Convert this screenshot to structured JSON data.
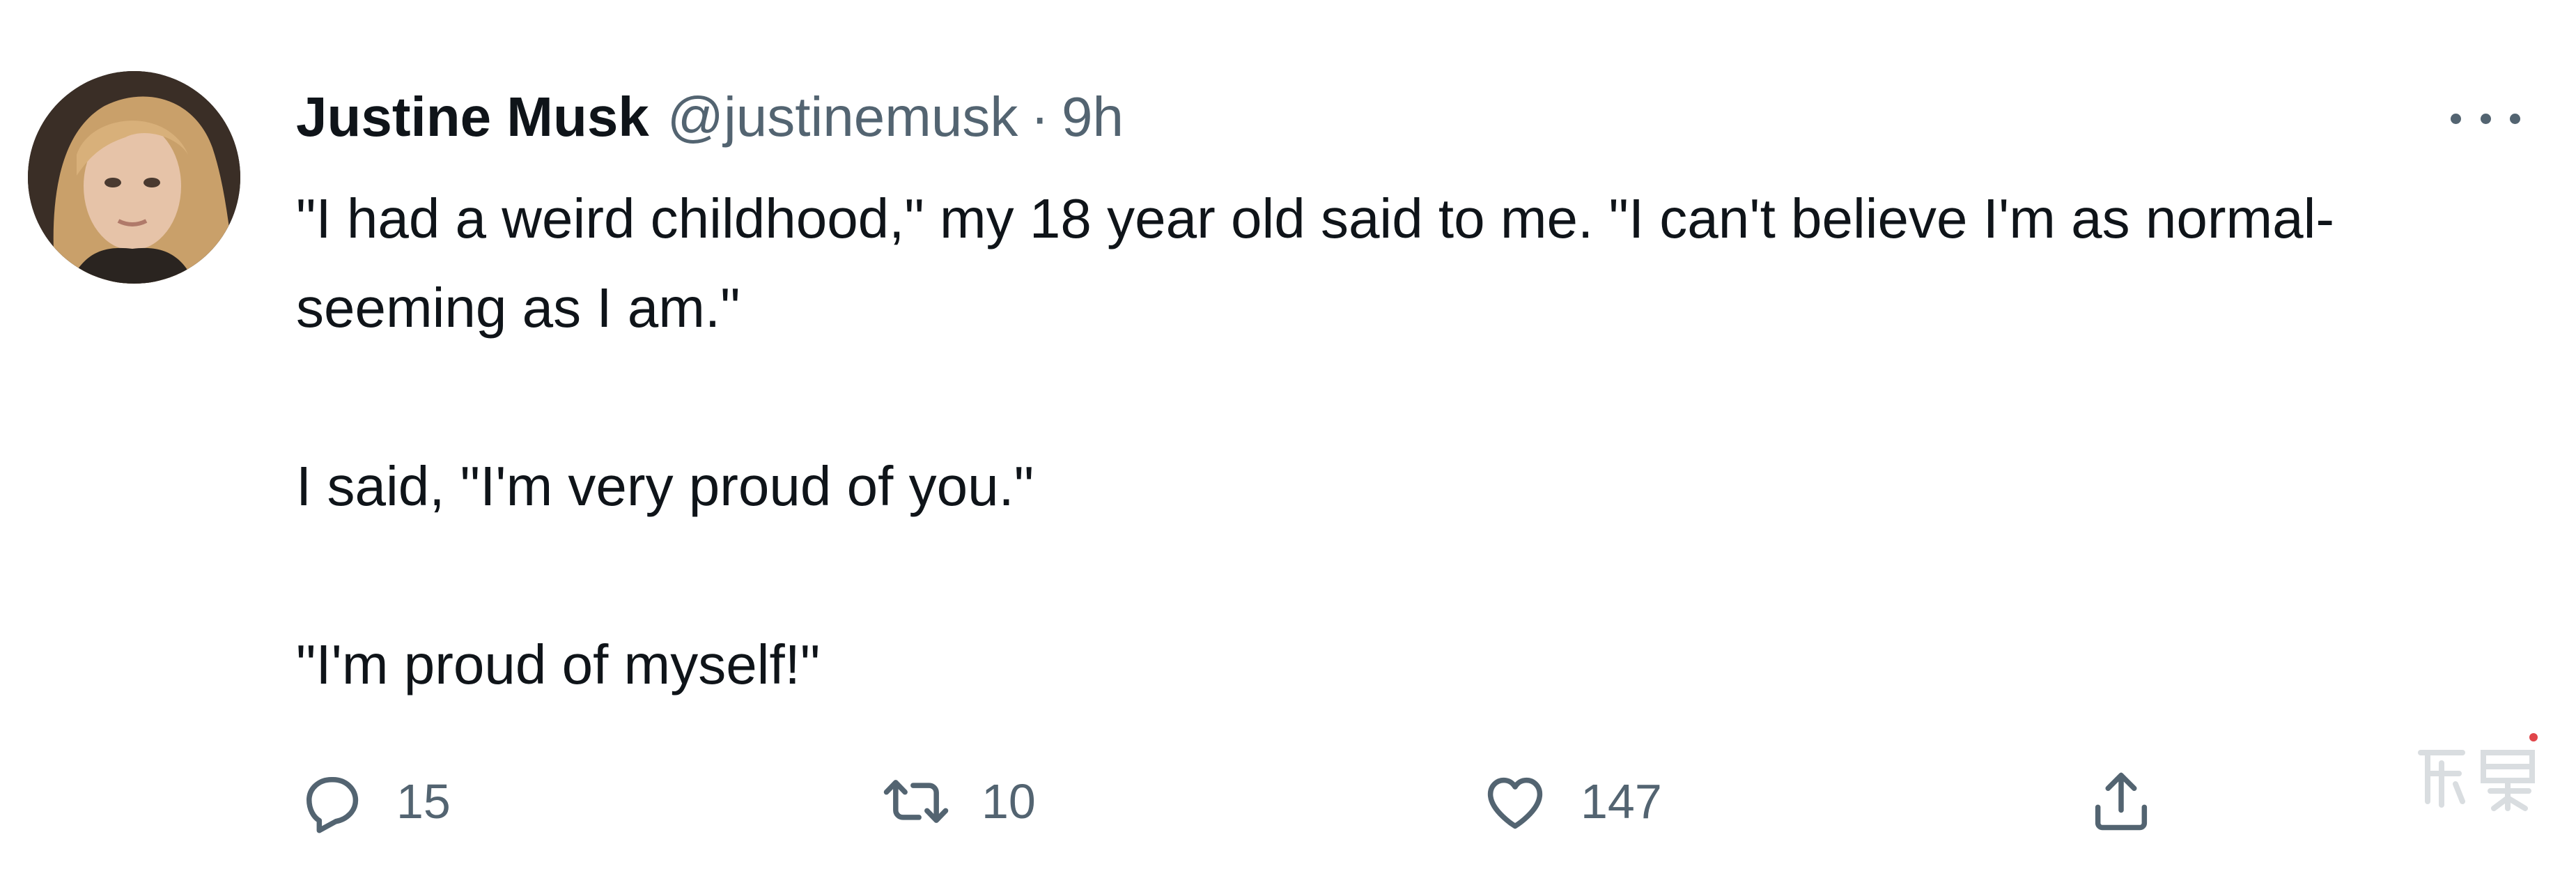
{
  "tweet": {
    "author": {
      "display_name": "Justine Musk",
      "handle": "@justinemusk"
    },
    "separator": "·",
    "time": "9h",
    "text": {
      "paragraph_1": "\"I had a weird childhood,\" my 18 year old said to me. \"I can't believe I'm as normal-seeming as I am.\"",
      "paragraph_2": "I said, \"I'm very proud of you.\"",
      "paragraph_3": "\"I'm proud of myself!\""
    },
    "actions": {
      "reply": {
        "icon": "reply-icon",
        "count": "15"
      },
      "retweet": {
        "icon": "retweet-icon",
        "count": "10"
      },
      "like": {
        "icon": "heart-icon",
        "count": "147"
      },
      "share": {
        "icon": "share-icon"
      }
    },
    "more_icon": "more-horizontal-icon"
  },
  "colors": {
    "text_primary": "#0f1419",
    "text_secondary": "#536471",
    "background": "#ffffff"
  }
}
